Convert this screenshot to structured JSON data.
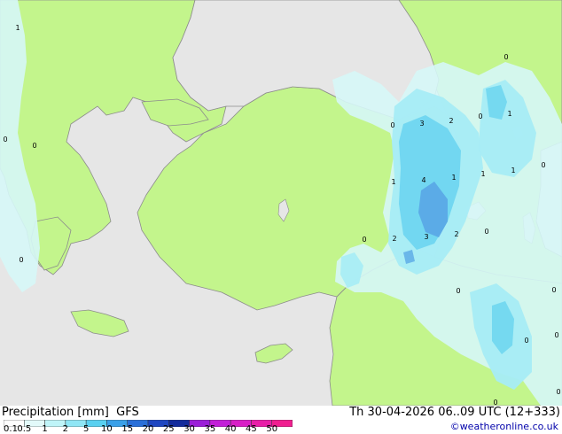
{
  "map": {
    "contour_labels": [
      {
        "text": "1"
      },
      {
        "text": "0"
      },
      {
        "text": "0"
      },
      {
        "text": "0"
      },
      {
        "text": "0"
      },
      {
        "text": "3"
      },
      {
        "text": "2"
      },
      {
        "text": "0"
      },
      {
        "text": "1"
      },
      {
        "text": "0"
      },
      {
        "text": "1"
      },
      {
        "text": "4"
      },
      {
        "text": "1"
      },
      {
        "text": "1"
      },
      {
        "text": "1"
      },
      {
        "text": "0"
      },
      {
        "text": "0"
      },
      {
        "text": "2"
      },
      {
        "text": "3"
      },
      {
        "text": "2"
      },
      {
        "text": "0"
      },
      {
        "text": "0"
      },
      {
        "text": "0"
      },
      {
        "text": "0"
      },
      {
        "text": "0"
      },
      {
        "text": "0"
      },
      {
        "text": "0"
      }
    ],
    "colors": {
      "land": "#c3f58c",
      "sea": "#e6e6e6",
      "coast": "#8c8c8c",
      "precip_light": "#d6f7f7",
      "precip_mid": "#a6ecf5",
      "precip_high": "#6fd6f0",
      "precip_core": "#5aa9e6"
    }
  },
  "legend": {
    "title": "Precipitation [mm]  GFS",
    "datetime": "Th 30-04-2026 06..09 UTC (12+333)",
    "credit": "©weatheronline.co.uk",
    "scale": [
      {
        "label": "0.1",
        "color": "#ffffff"
      },
      {
        "label": "0.5",
        "color": "#e2f9f9"
      },
      {
        "label": "1",
        "color": "#bff4f8"
      },
      {
        "label": "2",
        "color": "#8fe6f5"
      },
      {
        "label": "5",
        "color": "#59d0f0"
      },
      {
        "label": "10",
        "color": "#3aa0e8"
      },
      {
        "label": "15",
        "color": "#2a6fd8"
      },
      {
        "label": "20",
        "color": "#1e46c0"
      },
      {
        "label": "25",
        "color": "#142c9c"
      },
      {
        "label": "30",
        "color": "#9b1fd8"
      },
      {
        "label": "35",
        "color": "#c21fd8"
      },
      {
        "label": "40",
        "color": "#d81fc6"
      },
      {
        "label": "45",
        "color": "#e81fa8"
      },
      {
        "label": "50",
        "color": "#f01f90"
      }
    ]
  }
}
